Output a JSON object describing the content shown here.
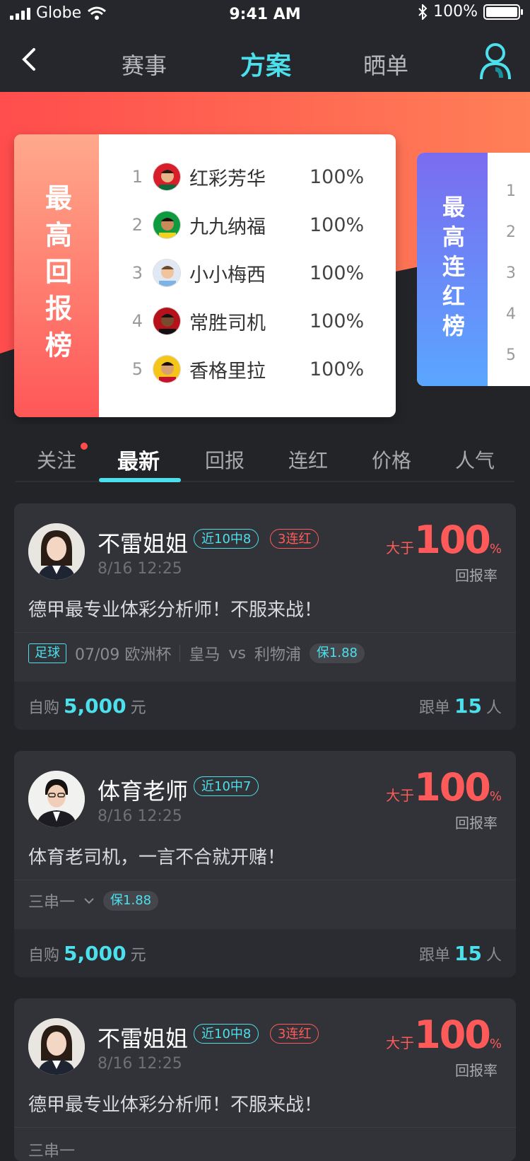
{
  "status": {
    "carrier": "Globe",
    "time": "9:41 AM",
    "battery": "100%"
  },
  "nav": {
    "tabs": [
      "赛事",
      "方案",
      "晒单"
    ],
    "active": 1
  },
  "rank_board_1": {
    "title": "最高回报榜",
    "rows": [
      {
        "rank": "1",
        "name": "红彩芳华",
        "value": "100%"
      },
      {
        "rank": "2",
        "name": "九九纳福",
        "value": "100%"
      },
      {
        "rank": "3",
        "name": "小小梅西",
        "value": "100%"
      },
      {
        "rank": "4",
        "name": "常胜司机",
        "value": "100%"
      },
      {
        "rank": "5",
        "name": "香格里拉",
        "value": "100%"
      }
    ]
  },
  "rank_board_2": {
    "title": "最高连红榜",
    "ranks": [
      "1",
      "2",
      "3",
      "4",
      "5"
    ]
  },
  "filter_tabs": {
    "items": [
      "关注",
      "最新",
      "回报",
      "连红",
      "价格",
      "人气"
    ],
    "active": 1
  },
  "cards": [
    {
      "name": "不雷姐姐",
      "badge_teal": "近10中8",
      "badge_red": "3连红",
      "time": "8/16 12:25",
      "ret_prefix": "大于",
      "ret_value": "100",
      "ret_unit": "%",
      "ret_label": "回报率",
      "desc": "德甲最专业体彩分析师！不服来战！",
      "sport": "足球",
      "match_date": "07/09 欧洲杯",
      "home": "皇马",
      "vs": "vs",
      "away": "利物浦",
      "bao": "保1.88",
      "buy_label": "自购",
      "buy_amount": "5,000",
      "buy_unit": "元",
      "follow_label": "跟单",
      "follow_count": "15",
      "follow_unit": "人"
    },
    {
      "name": "体育老师",
      "badge_teal": "近10中7",
      "time": "8/16 12:25",
      "ret_prefix": "大于",
      "ret_value": "100",
      "ret_unit": "%",
      "ret_label": "回报率",
      "desc": "体育老司机，一言不合就开赌！",
      "combo": "三串一",
      "bao": "保1.88",
      "buy_label": "自购",
      "buy_amount": "5,000",
      "buy_unit": "元",
      "follow_label": "跟单",
      "follow_count": "15",
      "follow_unit": "人"
    },
    {
      "name": "不雷姐姐",
      "badge_teal": "近10中8",
      "badge_red": "3连红",
      "time": "8/16 12:25",
      "ret_prefix": "大于",
      "ret_value": "100",
      "ret_unit": "%",
      "ret_label": "回报率",
      "desc": "德甲最专业体彩分析师！不服来战！",
      "combo": "三串一"
    }
  ],
  "colors": {
    "accent": "#4be0ec",
    "hot": "#ff5a5a",
    "bg": "#232428",
    "card": "#323338"
  }
}
